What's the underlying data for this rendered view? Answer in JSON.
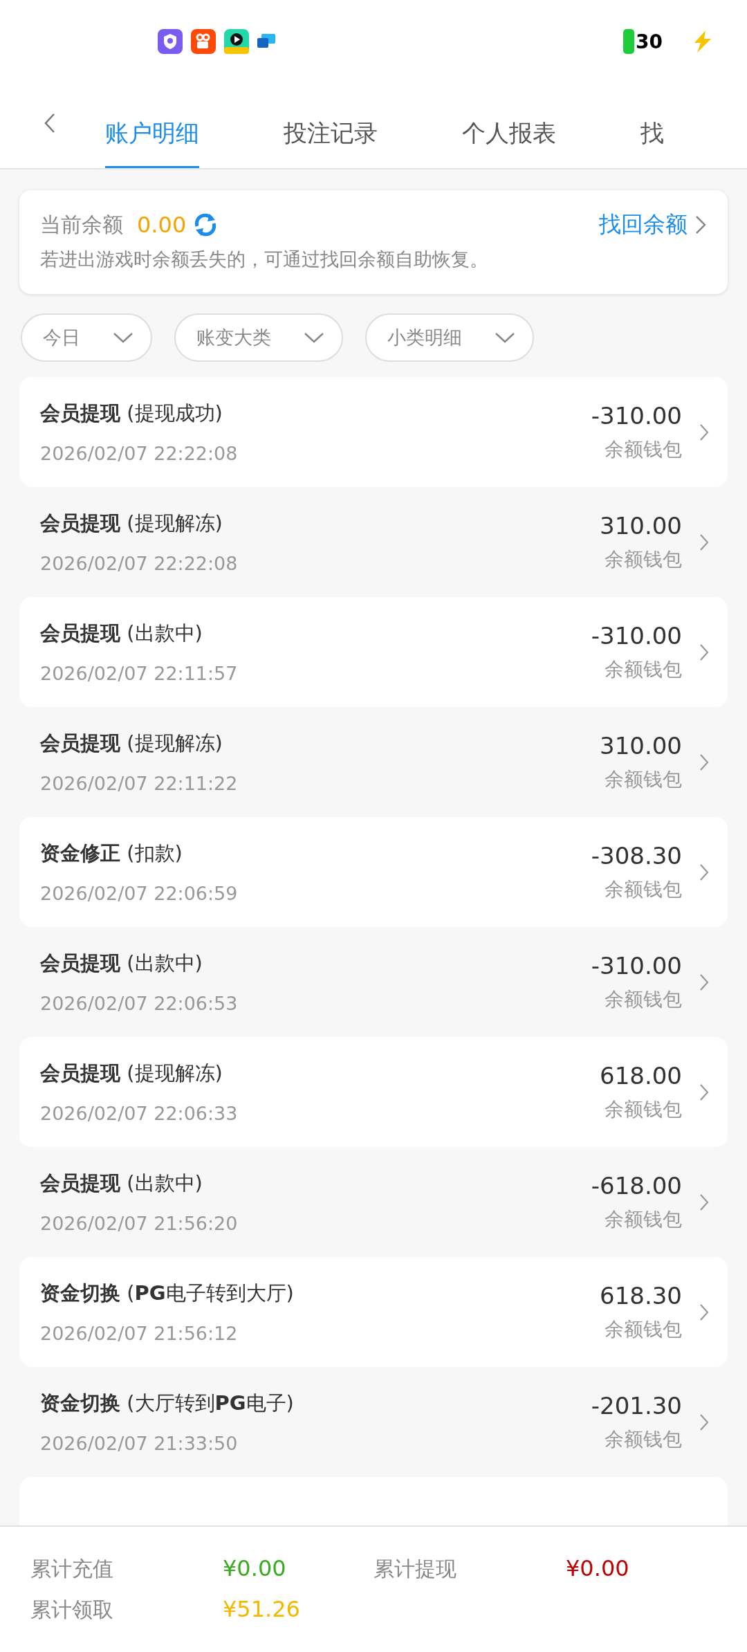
{
  "status_bar": {
    "battery": "30"
  },
  "tabs": [
    {
      "label": "账户明细",
      "selected": true
    },
    {
      "label": "投注记录",
      "selected": false
    },
    {
      "label": "个人报表",
      "selected": false
    },
    {
      "label": "找",
      "selected": false
    }
  ],
  "balance_card": {
    "label": "当前余额",
    "amount": "0.00",
    "link": "找回余额",
    "note": "若进出游戏时余额丢失的，可通过找回余额自助恢复。"
  },
  "filters": [
    {
      "label": "今日"
    },
    {
      "label": "账变大类"
    },
    {
      "label": "小类明细"
    }
  ],
  "records": [
    {
      "type": "会员提现",
      "detail": "(提现成功)",
      "time": "2026/02/07 22:22:08",
      "amount": "-310.00",
      "wallet": "余额钱包"
    },
    {
      "type": "会员提现",
      "detail": "(提现解冻)",
      "time": "2026/02/07 22:22:08",
      "amount": "310.00",
      "wallet": "余额钱包"
    },
    {
      "type": "会员提现",
      "detail": "(出款中)",
      "time": "2026/02/07 22:11:57",
      "amount": "-310.00",
      "wallet": "余额钱包"
    },
    {
      "type": "会员提现",
      "detail": "(提现解冻)",
      "time": "2026/02/07 22:11:22",
      "amount": "310.00",
      "wallet": "余额钱包"
    },
    {
      "type": "资金修正",
      "detail": "(扣款)",
      "time": "2026/02/07 22:06:59",
      "amount": "-308.30",
      "wallet": "余额钱包"
    },
    {
      "type": "会员提现",
      "detail": "(出款中)",
      "time": "2026/02/07 22:06:53",
      "amount": "-310.00",
      "wallet": "余额钱包"
    },
    {
      "type": "会员提现",
      "detail": "(提现解冻)",
      "time": "2026/02/07 22:06:33",
      "amount": "618.00",
      "wallet": "余额钱包"
    },
    {
      "type": "会员提现",
      "detail": "(出款中)",
      "time": "2026/02/07 21:56:20",
      "amount": "-618.00",
      "wallet": "余额钱包"
    },
    {
      "type": "资金切换",
      "detail": "(**PG**电子转到大厅)",
      "time": "2026/02/07 21:56:12",
      "amount": "618.30",
      "wallet": "余额钱包"
    },
    {
      "type": "资金切换",
      "detail": "(大厅转到**PG**电子)",
      "time": "2026/02/07 21:33:50",
      "amount": "-201.30",
      "wallet": "余额钱包"
    }
  ],
  "totals": [
    {
      "label": "累计充值",
      "value": "¥0.00",
      "color": "#3aaa1f"
    },
    {
      "label": "累计提现",
      "value": "¥0.00",
      "color": "#c00000"
    },
    {
      "label": "累计领取",
      "value": "¥51.26",
      "color": "#f5b800"
    }
  ]
}
